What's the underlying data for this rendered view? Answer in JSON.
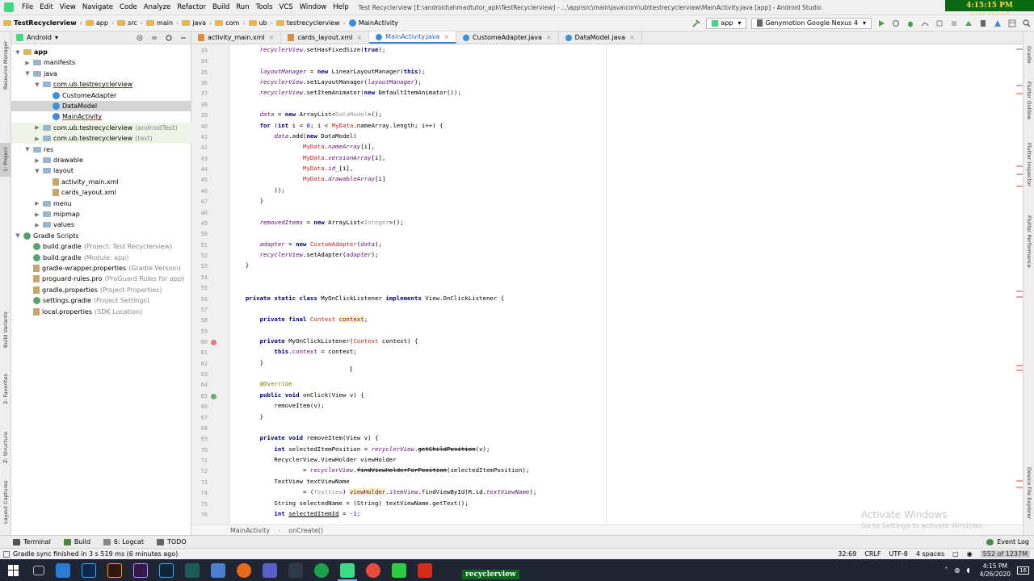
{
  "window": {
    "title": "Test Recyclerview [E:\\android\\ahmadtutor_apk\\TestRecyclerview] - ...\\app\\src\\main\\java\\com\\ub\\testrecyclerview\\MainActivity.java [app] - Android Studio",
    "clock_overlay": "4:15:15 PM 4/26/2020"
  },
  "menu": [
    "File",
    "Edit",
    "View",
    "Navigate",
    "Code",
    "Analyze",
    "Refactor",
    "Build",
    "Run",
    "Tools",
    "VCS",
    "Window",
    "Help"
  ],
  "breadcrumbs": [
    "TestRecyclerview",
    "app",
    "src",
    "main",
    "java",
    "com",
    "ub",
    "testrecyclerview",
    "MainActivity"
  ],
  "toolbar": {
    "run_config": "app",
    "device": "Genymotion Google Nexus 4"
  },
  "left_tabs": [
    "Resource Manager",
    "1: Project",
    "Build Variants",
    "2: Favorites",
    "Z: Structure",
    "Layout Captures"
  ],
  "right_tabs": [
    "Gradle",
    "Flutter Outline",
    "Flutter Inspector",
    "Flutter Performance",
    "Device File Explorer"
  ],
  "project": {
    "view_mode": "Android",
    "tree": [
      {
        "indent": 0,
        "arrow": "▼",
        "icon": "folder-y",
        "label": "app",
        "bold": true
      },
      {
        "indent": 1,
        "arrow": "▶",
        "icon": "folder",
        "label": "manifests"
      },
      {
        "indent": 1,
        "arrow": "▼",
        "icon": "folder",
        "label": "java"
      },
      {
        "indent": 2,
        "arrow": "▼",
        "icon": "folder",
        "label": "com.ub.testrecyclerview",
        "underline": true
      },
      {
        "indent": 3,
        "arrow": "",
        "icon": "class",
        "label": "CustomeAdapter"
      },
      {
        "indent": 3,
        "arrow": "",
        "icon": "class",
        "label": "DataModel",
        "selected": true
      },
      {
        "indent": 3,
        "arrow": "",
        "icon": "class",
        "label": "MainActivity",
        "underline": true
      },
      {
        "indent": 2,
        "arrow": "▶",
        "icon": "folder",
        "label": "com.ub.testrecyclerview",
        "hint": "(androidTest)",
        "test": true
      },
      {
        "indent": 2,
        "arrow": "▶",
        "icon": "folder",
        "label": "com.ub.testrecyclerview",
        "hint": "(test)",
        "test": true
      },
      {
        "indent": 1,
        "arrow": "▼",
        "icon": "folder",
        "label": "res"
      },
      {
        "indent": 2,
        "arrow": "▶",
        "icon": "folder",
        "label": "drawable"
      },
      {
        "indent": 2,
        "arrow": "▼",
        "icon": "folder",
        "label": "layout"
      },
      {
        "indent": 3,
        "arrow": "",
        "icon": "file",
        "label": "activity_main.xml"
      },
      {
        "indent": 3,
        "arrow": "",
        "icon": "file",
        "label": "cards_layout.xml"
      },
      {
        "indent": 2,
        "arrow": "▶",
        "icon": "folder",
        "label": "menu"
      },
      {
        "indent": 2,
        "arrow": "▶",
        "icon": "folder",
        "label": "mipmap"
      },
      {
        "indent": 2,
        "arrow": "▶",
        "icon": "folder",
        "label": "values"
      },
      {
        "indent": 0,
        "arrow": "▼",
        "icon": "gradle",
        "label": "Gradle Scripts"
      },
      {
        "indent": 1,
        "arrow": "",
        "icon": "gradle",
        "label": "build.gradle",
        "hint": "(Project: Test Recyclerview)"
      },
      {
        "indent": 1,
        "arrow": "",
        "icon": "gradle",
        "label": "build.gradle",
        "hint": "(Module: app)"
      },
      {
        "indent": 1,
        "arrow": "",
        "icon": "file",
        "label": "gradle-wrapper.properties",
        "hint": "(Gradle Version)"
      },
      {
        "indent": 1,
        "arrow": "",
        "icon": "file",
        "label": "proguard-rules.pro",
        "hint": "(ProGuard Rules for app)"
      },
      {
        "indent": 1,
        "arrow": "",
        "icon": "file",
        "label": "gradle.properties",
        "hint": "(Project Properties)"
      },
      {
        "indent": 1,
        "arrow": "",
        "icon": "gradle",
        "label": "settings.gradle",
        "hint": "(Project Settings)"
      },
      {
        "indent": 1,
        "arrow": "",
        "icon": "file",
        "label": "local.properties",
        "hint": "(SDK Location)"
      }
    ]
  },
  "editor_tabs": [
    {
      "label": "activity_main.xml",
      "kind": "xml"
    },
    {
      "label": "cards_layout.xml",
      "kind": "xml"
    },
    {
      "label": "MainActivity.java",
      "kind": "class",
      "active": true
    },
    {
      "label": "CustomeAdapter.java",
      "kind": "class"
    },
    {
      "label": "DataModel.java",
      "kind": "class"
    }
  ],
  "code": [
    {
      "n": 33,
      "html": "        <span class='fld'>recyclerView</span>.setHasFixedSize(<span class='kw'>true</span>);"
    },
    {
      "n": 34,
      "html": ""
    },
    {
      "n": 35,
      "html": "        <span class='fld'>layoutManager</span> = <span class='kw'>new</span> LinearLayoutManager(<span class='kw'>this</span>);"
    },
    {
      "n": 36,
      "html": "        <span class='fld'>recyclerView</span>.setLayoutManager(<span class='fld'>layoutManager</span>);"
    },
    {
      "n": 37,
      "html": "        <span class='fld'>recyclerView</span>.setItemAnimator(<span class='kw'>new</span> DefaultItemAnimator());"
    },
    {
      "n": 38,
      "html": ""
    },
    {
      "n": 39,
      "html": "        <span class='fld'>data</span> = <span class='kw'>new</span> ArrayList&lt;<span class='gen'>DataModel</span>&gt;();"
    },
    {
      "n": 40,
      "html": "        <span class='kw'>for</span> (<span class='kw'>int</span> i = <span style='color:#0000ff'>0</span>; i &lt; <span class='sfld'>MyData</span>.nameArray.length; i++) {"
    },
    {
      "n": 41,
      "html": "            <span class='fld'>data</span>.add(<span class='kw'>new</span> DataModel("
    },
    {
      "n": 42,
      "html": "                    <span class='sfld'>MyData</span>.<span class='fld'>nameArray</span>[i],"
    },
    {
      "n": 43,
      "html": "                    <span class='sfld'>MyData</span>.<span class='fld'>versionArray</span>[i],"
    },
    {
      "n": 44,
      "html": "                    <span class='sfld'>MyData</span>.<span class='fld'>id_</span>[i],"
    },
    {
      "n": 45,
      "html": "                    <span class='sfld'>MyData</span>.<span class='fld'>drawableArray</span>[i]"
    },
    {
      "n": 46,
      "html": "            ));"
    },
    {
      "n": 47,
      "html": "        }"
    },
    {
      "n": 48,
      "html": ""
    },
    {
      "n": 49,
      "html": "        <span class='fld'>removedItems</span> = <span class='kw'>new</span> ArrayList&lt;<span class='gen'>Integer</span>&gt;();"
    },
    {
      "n": 50,
      "html": ""
    },
    {
      "n": 51,
      "html": "        <span class='fld'>adapter</span> = <span class='kw'>new</span> <span class='sfld'>CustomAdapter</span>(<span class='fld'>data</span>);"
    },
    {
      "n": 52,
      "html": "        <span class='fld'>recyclerView</span>.setAdapter(<span class='fld'>adapter</span>);"
    },
    {
      "n": 53,
      "html": "    }"
    },
    {
      "n": 54,
      "html": ""
    },
    {
      "n": 55,
      "html": ""
    },
    {
      "n": 56,
      "html": "    <span class='kw'>private static class</span> MyOnClickListener <span class='kw'>implements</span> View.OnClickListener {"
    },
    {
      "n": 57,
      "html": ""
    },
    {
      "n": 58,
      "html": "        <span class='kw'>private final</span> <span class='sfld'>Context</span> <span class='hl' style='color:#660e7a'>context</span>;"
    },
    {
      "n": 59,
      "html": ""
    },
    {
      "n": 60,
      "html": "        <span class='kw'>private</span> MyOnClickListener(<span class='sfld'>Context</span> context) {"
    },
    {
      "n": 61,
      "html": "            <span class='kw'>this</span>.<span style='color:#660e7a'>context</span> = context;"
    },
    {
      "n": 62,
      "html": "        }"
    },
    {
      "n": 63,
      "html": ""
    },
    {
      "n": 64,
      "html": "        <span class='ann'>@Override</span>"
    },
    {
      "n": 65,
      "html": "        <span class='kw'>public void</span> onClick(View v) {"
    },
    {
      "n": 66,
      "html": "            removeItem(v);"
    },
    {
      "n": 67,
      "html": "        }"
    },
    {
      "n": 68,
      "html": ""
    },
    {
      "n": 69,
      "html": "        <span class='kw'>private void</span> removeItem(View v) {"
    },
    {
      "n": 70,
      "html": "            <span class='kw'>int</span> selectedItemPosition = <span class='fld'>recyclerView</span>.<span class='strike'>getChildPosition</span>(v);"
    },
    {
      "n": 71,
      "html": "            RecyclerView.ViewHolder viewHolder"
    },
    {
      "n": 72,
      "html": "                    = <span class='fld'>recyclerView</span>.<span class='strike'>findViewHolderForPosition</span>(selectedItemPosition);"
    },
    {
      "n": 73,
      "html": "            TextView textViewName"
    },
    {
      "n": 74,
      "html": "                    = (<span class='gen'>TextView</span>) <span class='hl' style='color:#660e7a'>viewHolder</span>.<span style='color:#660e7a'>itemView</span>.findViewById(R.id.<span class='fld'>textViewName</span>);"
    },
    {
      "n": 75,
      "html": "            String selectedName = (String) textViewName.getText();"
    },
    {
      "n": 76,
      "html": "            <span class='kw'>int</span> <span style='text-decoration:underline'>selectedItemId</span> = -<span style='color:#0000ff'>1</span>;"
    }
  ],
  "editor_crumbs": [
    "MainActivity",
    "onCreate()"
  ],
  "watermark": {
    "line1": "Activate Windows",
    "line2": "Go to Settings to activate Windows."
  },
  "toolwindows": [
    "Terminal",
    "Build",
    "6: Logcat",
    "TODO"
  ],
  "event_log": "Event Log",
  "status": {
    "message": "Gradle sync finished in 3 s 519 ms (6 minutes ago)",
    "position": "32:69",
    "line_sep": "CRLF",
    "encoding": "UTF-8",
    "indent": "4 spaces",
    "memory": "552 of 1237M"
  },
  "taskbar": {
    "label": "recyclerview",
    "time": "4:15 PM",
    "date": "4/26/2020",
    "notifications": "16"
  },
  "colors": {
    "accent": "#4083c9",
    "taskbar": "#1f2532",
    "overlay_green": "#0a6a14",
    "overlay_text": "#ffd84a"
  }
}
